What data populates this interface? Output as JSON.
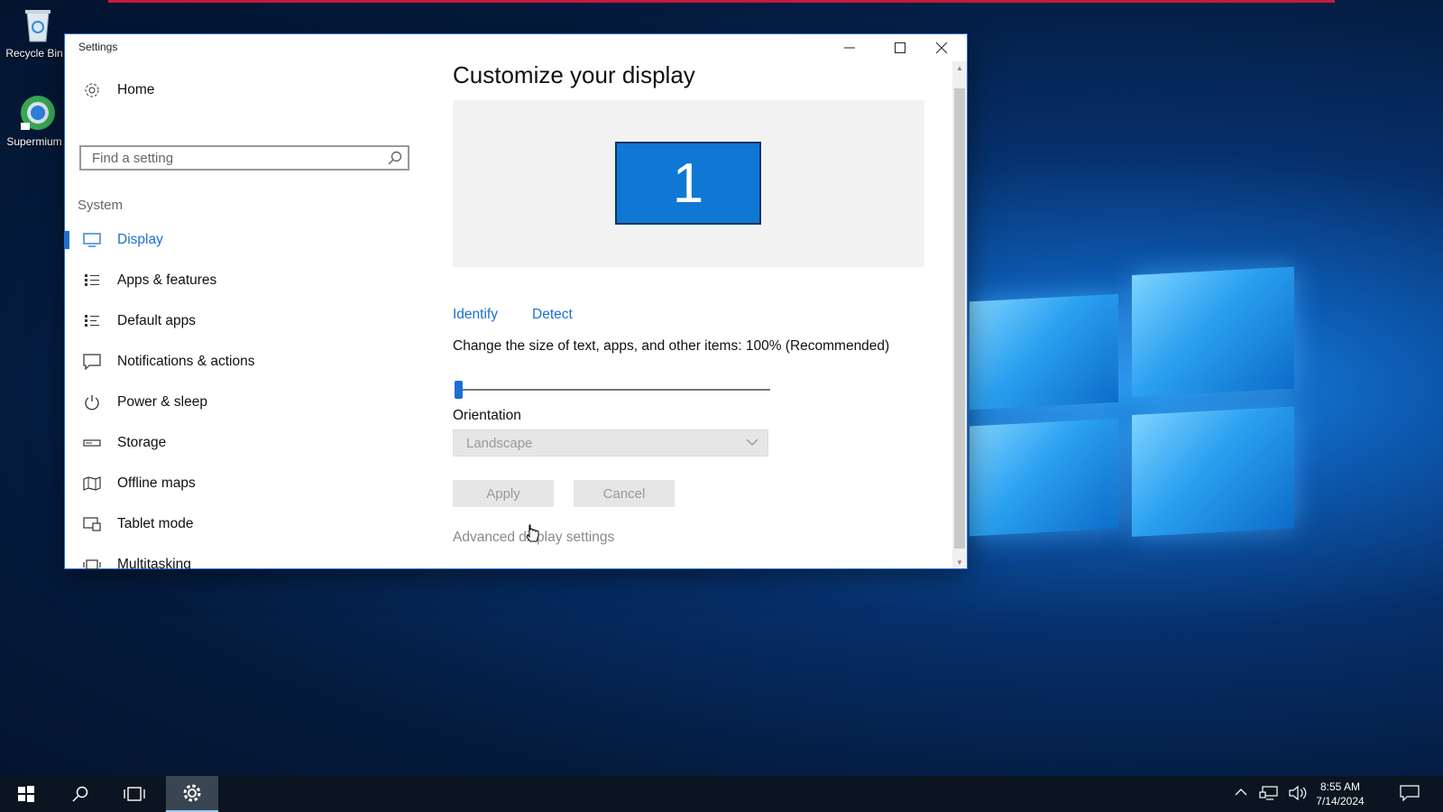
{
  "desktop": {
    "icons": [
      {
        "label": "Recycle Bin",
        "icon": "recycle-bin-icon"
      },
      {
        "label": "Supermium",
        "icon": "supermium-icon"
      }
    ]
  },
  "window": {
    "title": "Settings",
    "controls": {
      "minimize": "minimize-icon",
      "maximize": "maximize-icon",
      "close": "close-icon"
    }
  },
  "sidebar": {
    "home_label": "Home",
    "search_placeholder": "Find a setting",
    "section_label": "System",
    "items": [
      {
        "label": "Display",
        "icon": "monitor-icon",
        "active": true
      },
      {
        "label": "Apps & features",
        "icon": "apps-list-icon"
      },
      {
        "label": "Default apps",
        "icon": "default-apps-icon"
      },
      {
        "label": "Notifications & actions",
        "icon": "notification-icon"
      },
      {
        "label": "Power & sleep",
        "icon": "power-icon"
      },
      {
        "label": "Storage",
        "icon": "storage-icon"
      },
      {
        "label": "Offline maps",
        "icon": "map-icon"
      },
      {
        "label": "Tablet mode",
        "icon": "tablet-icon"
      },
      {
        "label": "Multitasking",
        "icon": "multitasking-icon"
      }
    ]
  },
  "main": {
    "heading": "Customize your display",
    "monitor_number": "1",
    "identify_label": "Identify",
    "detect_label": "Detect",
    "scale_text": "Change the size of text, apps, and other items: 100% (Recommended)",
    "scale_slider_fraction": 0,
    "orientation_label": "Orientation",
    "orientation_value": "Landscape",
    "apply_label": "Apply",
    "cancel_label": "Cancel",
    "advanced_link": "Advanced display settings"
  },
  "taskbar": {
    "time": "8:55 AM",
    "date": "7/14/2024",
    "accent": "#1c6fd1"
  }
}
